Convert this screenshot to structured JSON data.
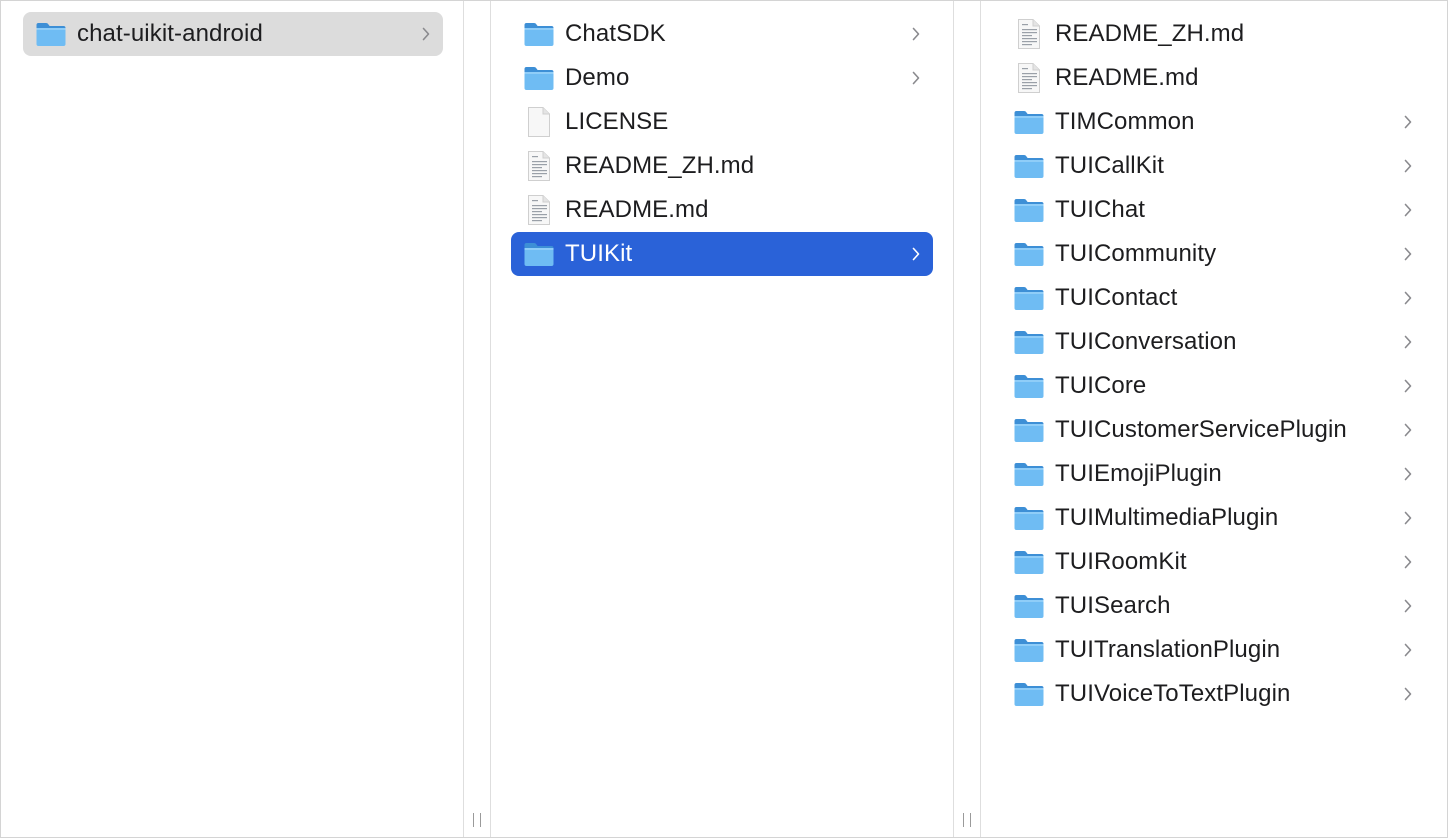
{
  "columns": [
    {
      "items": [
        {
          "label": "chat-uikit-android",
          "kind": "folder",
          "has_children": true,
          "selected": "gray"
        }
      ]
    },
    {
      "items": [
        {
          "label": "ChatSDK",
          "kind": "folder",
          "has_children": true,
          "selected": ""
        },
        {
          "label": "Demo",
          "kind": "folder",
          "has_children": true,
          "selected": ""
        },
        {
          "label": "LICENSE",
          "kind": "file-blank",
          "has_children": false,
          "selected": ""
        },
        {
          "label": "README_ZH.md",
          "kind": "file-text",
          "has_children": false,
          "selected": ""
        },
        {
          "label": "README.md",
          "kind": "file-text",
          "has_children": false,
          "selected": ""
        },
        {
          "label": "TUIKit",
          "kind": "folder",
          "has_children": true,
          "selected": "blue"
        }
      ]
    },
    {
      "items": [
        {
          "label": "README_ZH.md",
          "kind": "file-text",
          "has_children": false,
          "selected": ""
        },
        {
          "label": "README.md",
          "kind": "file-text",
          "has_children": false,
          "selected": ""
        },
        {
          "label": "TIMCommon",
          "kind": "folder",
          "has_children": true,
          "selected": ""
        },
        {
          "label": "TUICallKit",
          "kind": "folder",
          "has_children": true,
          "selected": ""
        },
        {
          "label": "TUIChat",
          "kind": "folder",
          "has_children": true,
          "selected": ""
        },
        {
          "label": "TUICommunity",
          "kind": "folder",
          "has_children": true,
          "selected": ""
        },
        {
          "label": "TUIContact",
          "kind": "folder",
          "has_children": true,
          "selected": ""
        },
        {
          "label": "TUIConversation",
          "kind": "folder",
          "has_children": true,
          "selected": ""
        },
        {
          "label": "TUICore",
          "kind": "folder",
          "has_children": true,
          "selected": ""
        },
        {
          "label": "TUICustomerServicePlugin",
          "kind": "folder",
          "has_children": true,
          "selected": ""
        },
        {
          "label": "TUIEmojiPlugin",
          "kind": "folder",
          "has_children": true,
          "selected": ""
        },
        {
          "label": "TUIMultimediaPlugin",
          "kind": "folder",
          "has_children": true,
          "selected": ""
        },
        {
          "label": "TUIRoomKit",
          "kind": "folder",
          "has_children": true,
          "selected": ""
        },
        {
          "label": "TUISearch",
          "kind": "folder",
          "has_children": true,
          "selected": ""
        },
        {
          "label": "TUITranslationPlugin",
          "kind": "folder",
          "has_children": true,
          "selected": ""
        },
        {
          "label": "TUIVoiceToTextPlugin",
          "kind": "folder",
          "has_children": true,
          "selected": ""
        }
      ]
    }
  ],
  "colors": {
    "selection_blue": "#2a62d8",
    "selection_gray": "#dcdcdc",
    "folder_blue": "#5fb0ee"
  },
  "icons": {
    "folder": "folder-icon",
    "file-blank": "blank-file-icon",
    "file-text": "text-file-icon",
    "chevron": "chevron-right-icon",
    "divider": "column-resize-handle"
  }
}
